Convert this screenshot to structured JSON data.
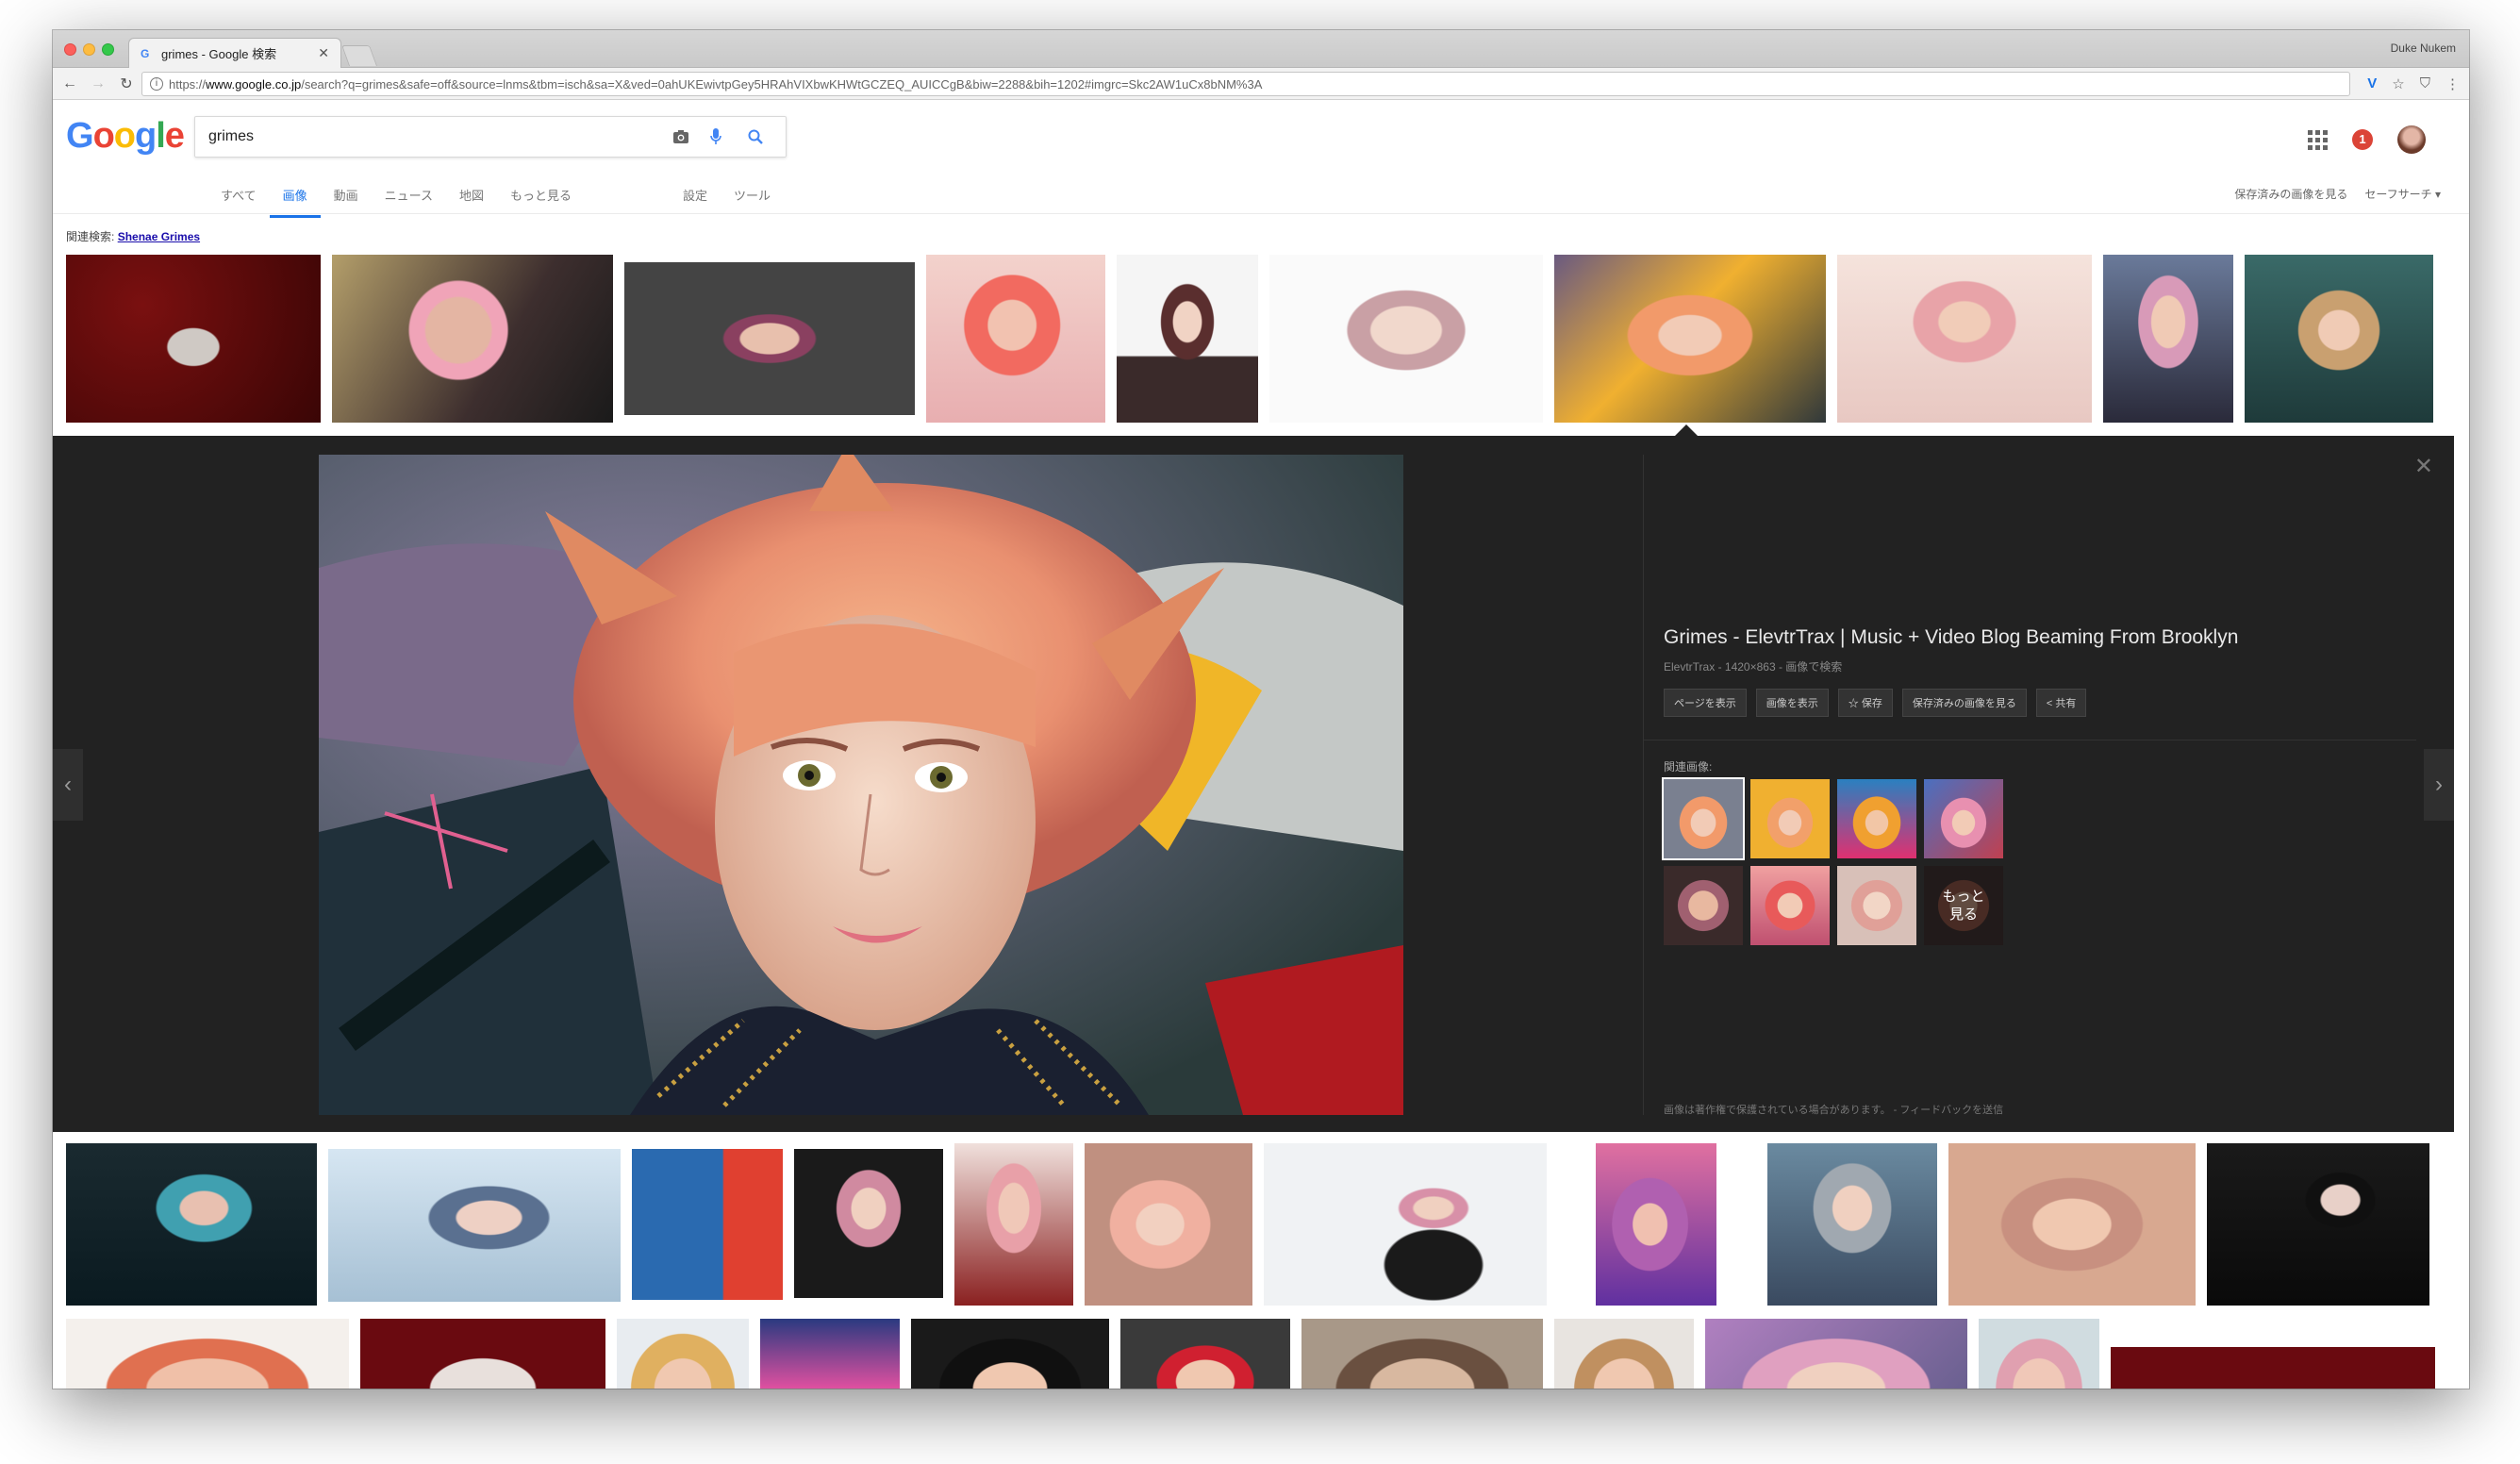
{
  "browser": {
    "tab_title": "grimes - Google 検索",
    "tab_favicon": "G",
    "profile_name": "Duke Nukem",
    "url_prefix": "https://",
    "url_host": "www.google.co.jp",
    "url_rest": "/search?q=grimes&safe=off&source=lnms&tbm=isch&sa=X&ved=0ahUKEwivtpGey5HRAhVIXbwKHWtGCZEQ_AUICCgB&biw=2288&bih=1202#imgrc=Skc2AW1uCx8bNM%3A",
    "toolbar_icons": [
      "v-extension-icon",
      "star-icon",
      "shield-icon",
      "menu-icon"
    ]
  },
  "google": {
    "logo": [
      "G",
      "o",
      "o",
      "g",
      "l",
      "e"
    ],
    "search_value": "grimes",
    "notifications": "1",
    "tabs": [
      "すべて",
      "画像",
      "動画",
      "ニュース",
      "地図",
      "もっと見る",
      "設定",
      "ツール"
    ],
    "active_tab": "画像",
    "right_links": [
      "保存済みの画像を見る",
      "セーフサーチ ▾"
    ],
    "related_label": "関連検索:",
    "related_link": "Shenae Grimes"
  },
  "viewer": {
    "title": "Grimes - ElevtrTrax | Music + Video Blog Beaming From Brooklyn",
    "subtitle": "ElevtrTrax - 1420×863 - 画像で検索",
    "buttons": [
      "ページを表示",
      "画像を表示",
      "☆ 保存",
      "保存済みの画像を見る",
      "< 共有"
    ],
    "related_label": "関連画像:",
    "more_label_1": "もっと",
    "more_label_2": "見る",
    "footer": "画像は著作権で保護されている場合があります。 - フィードバックを送信"
  },
  "colors": {
    "accent": "#1a73e8",
    "viewer_bg": "#222222",
    "link": "#1a0dab"
  }
}
